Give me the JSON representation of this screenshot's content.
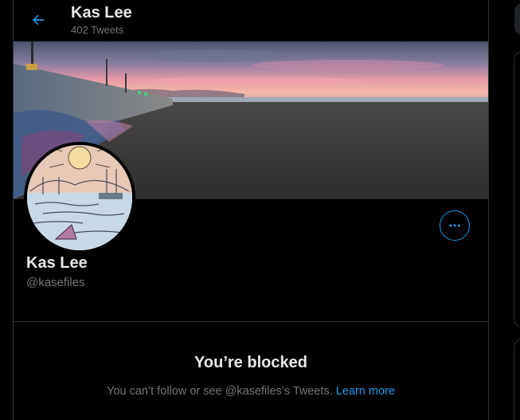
{
  "header": {
    "title": "Kas Lee",
    "tweet_count": "402 Tweets"
  },
  "profile": {
    "name": "Kas Lee",
    "handle": "@kasefiles"
  },
  "blocked": {
    "title": "You’re blocked",
    "message": "You can’t follow or see @kasefiles’s Tweets.",
    "link": "Learn more"
  },
  "colors": {
    "accent": "#1d9bf0",
    "background": "#000000",
    "secondary_text": "#71767b",
    "border": "#2f3336"
  },
  "icons": {
    "back": "arrow-left-icon",
    "more": "more-horizontal-icon"
  }
}
